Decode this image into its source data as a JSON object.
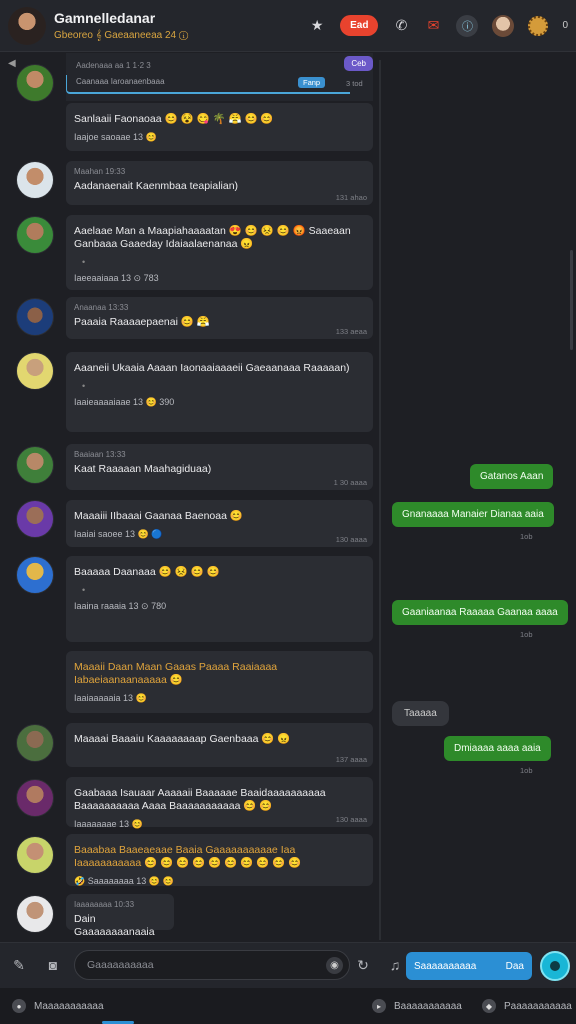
{
  "header": {
    "title": "Gamnelledanar",
    "subtitle": "Gbeoreo 𝄞 Gaeaaneeaa 24 ⓘ",
    "live_label": "Ead",
    "count": "0"
  },
  "reply_preview": {
    "tag": "Ceb",
    "meta": "Caanaaa Iaroanaenbaaa",
    "chip": "Fanp",
    "time": "3 tod"
  },
  "reply_meta_top": "Aadenaaa aa 1 1·2 3",
  "messages": [
    {
      "meta": "",
      "body": "Sanlaaii Faonaoaa 😊 😵 😋 🌴 😤 😊 😊",
      "reactions": "Iaajoe saoaae 13  😊",
      "ts": ""
    },
    {
      "meta": "Maahan  19:33",
      "body": "Aadanaenait Kaenmbaa teapialian)",
      "reactions": "",
      "ts": "131 ahao"
    },
    {
      "meta": "",
      "body": "Aaelaae Man a Maapiahaaaatan 😍 😊 😣 😊 😡 Saaeaan Ganbaaa Gaaeday Idaiaalaenanaa 😠",
      "reactions": "Iaeeaaiaaa 13  ⊙ 783",
      "ts": ""
    },
    {
      "meta": "Anaanaa  13:33",
      "body": "Paaaia Raaaaepaenai 😊 😤",
      "reactions": "",
      "ts": "133 aeaa"
    },
    {
      "meta": "",
      "body": "Aaaneii Ukaaia Aaaan Iaonaaiaaaeii Gaeaanaaa Raaaaan)",
      "reactions": "Iaaieaaaaiaae 13  😊 390",
      "ts": ""
    },
    {
      "meta": "Baaiaan  13:33",
      "body": "Kaat Raaaaan Maahagiduaa)",
      "reactions": "",
      "ts": "1 30 aaaa"
    },
    {
      "meta": "",
      "body": "Maaaiii IIbaaai Gaanaa Baenoaa 😊",
      "reactions": "Iaaiai saoee 13  😊 🔵",
      "ts": "130 aaaa"
    },
    {
      "meta": "",
      "body": "Baaaaa Daanaaa 😊 😣 😊 😊",
      "reactions": "Iaaina raaaia 13  ⊙ 780",
      "ts": ""
    },
    {
      "meta": "",
      "body": "Maaaii Daan Maan Gaaas Paaaa Raaiaaaa Iabaeiaanaanaaaaa 😊",
      "reactions": "Iaaiaaaaaia 13  😊",
      "ts": ""
    },
    {
      "meta": "",
      "body": "Maaaai Baaaiu Kaaaaaaaap Gaenbaaa 😊 😠",
      "reactions": "",
      "ts": "137 aaaa"
    },
    {
      "meta": "",
      "body": "Gaabaaa Isauaar Aaaaaii Baaaaae Baaidaaaaaaaaaa Baaaaaaaaaa Aaaa Baaaaaaaaaaa 😊 😊",
      "reactions": "Iaaaaaaae 13  😊",
      "ts": "130 aaaa"
    },
    {
      "meta": "",
      "body": "Baaabaa Baaeaeaae Baaia Gaaaaaaaaaae Iaa Iaaaaaaaaaaa 😊 😊 😊 😊 😊 😊 😊 😊 😊 😊",
      "reactions": "🤣 Saaaaaaaa 13 😊 😊",
      "ts": ""
    },
    {
      "meta": "Iaaaaaaaa  10:33",
      "body": "Dain Gaaaaaaaanaaia",
      "reactions": "",
      "ts": ""
    }
  ],
  "bubbles": [
    {
      "text": "Gatanos Aaan",
      "time": ""
    },
    {
      "text": "Gnanaaaa Manaier Dianaa aaia",
      "time": "1ob"
    },
    {
      "text": "Gaaniaanaa Raaaaa Gaanaa aaaa",
      "time": "1ob"
    },
    {
      "text": "Dmiaaaa aaaa aaia",
      "time": "1ob"
    }
  ],
  "grey_bubble": "Taaaaa",
  "compose": {
    "placeholder": "Gaaaaaaaaaa",
    "send_area_label": "Saaaaaaaaaa",
    "send_label": "Daa"
  },
  "footer": {
    "left_label": "Maaaaaaaaaaa",
    "mid_label": "Baaaaaaaaaaa",
    "right_label": "Paaaaaaaaaaa"
  }
}
